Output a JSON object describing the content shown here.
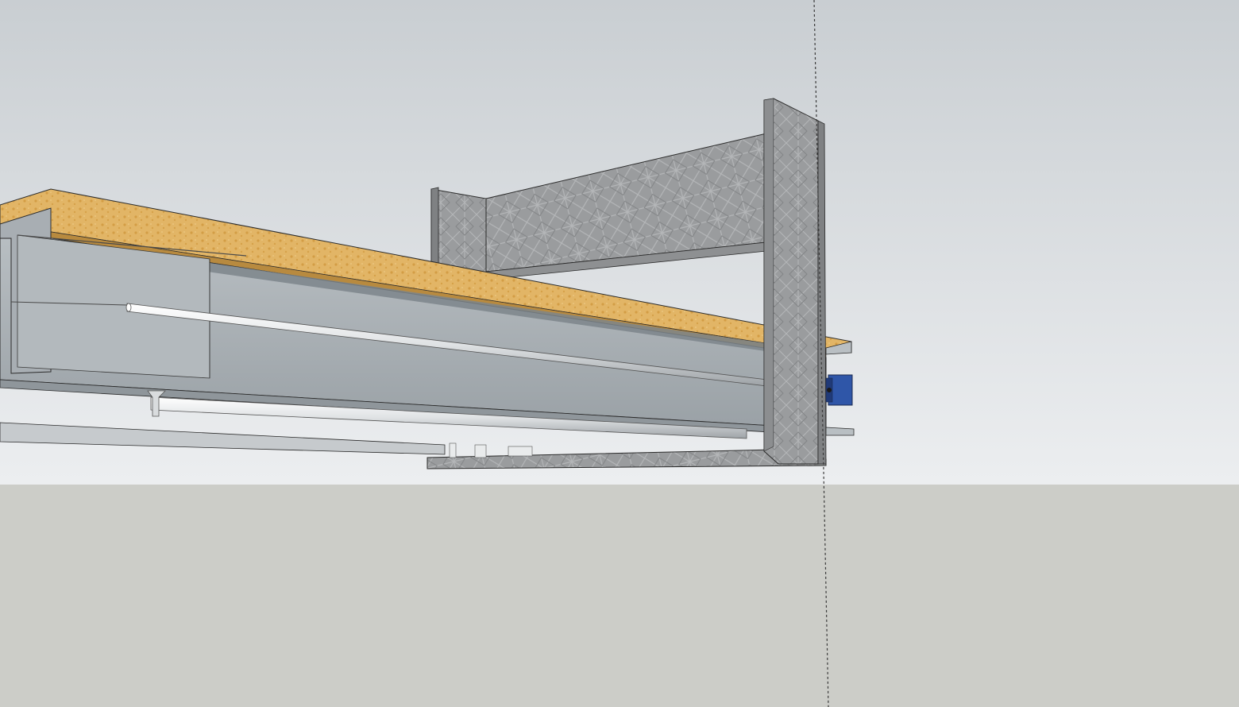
{
  "app": {
    "window_type": "sketchup-3d-viewport",
    "view": "perspective"
  },
  "scene": {
    "colors": {
      "sky_top": "#c9ced2",
      "sky_bottom": "#eceef0",
      "ground": "#cccdc8",
      "osb_board": "#e2b566",
      "osb_speck": "#c98d2e",
      "galvanized_steel": "#a9b0b5",
      "galvanized_dark": "#7d858b",
      "diamond_plate": "#9a9c9e",
      "diamond_plate_shadow": "#7f8183",
      "rod": "#eef0f1",
      "motor_blue": "#2f56a8",
      "edge": "#2b2b2b",
      "axis_guide": "#3a3a3a"
    },
    "objects": [
      {
        "name": "osb-top-board",
        "material": "osb"
      },
      {
        "name": "steel-beam-body",
        "material": "galvanized-steel"
      },
      {
        "name": "linear-rod",
        "material": "steel-rod"
      },
      {
        "name": "lower-rail",
        "material": "steel-rod"
      },
      {
        "name": "gantry-upright",
        "material": "diamond-plate"
      },
      {
        "name": "gantry-crossbeam",
        "material": "diamond-plate"
      },
      {
        "name": "gantry-left-post",
        "material": "diamond-plate"
      },
      {
        "name": "gantry-foot-plate",
        "material": "diamond-plate"
      },
      {
        "name": "stepper-motor",
        "material": "blue-plastic"
      },
      {
        "name": "blue-axis-guide",
        "style": "dashed"
      }
    ]
  }
}
